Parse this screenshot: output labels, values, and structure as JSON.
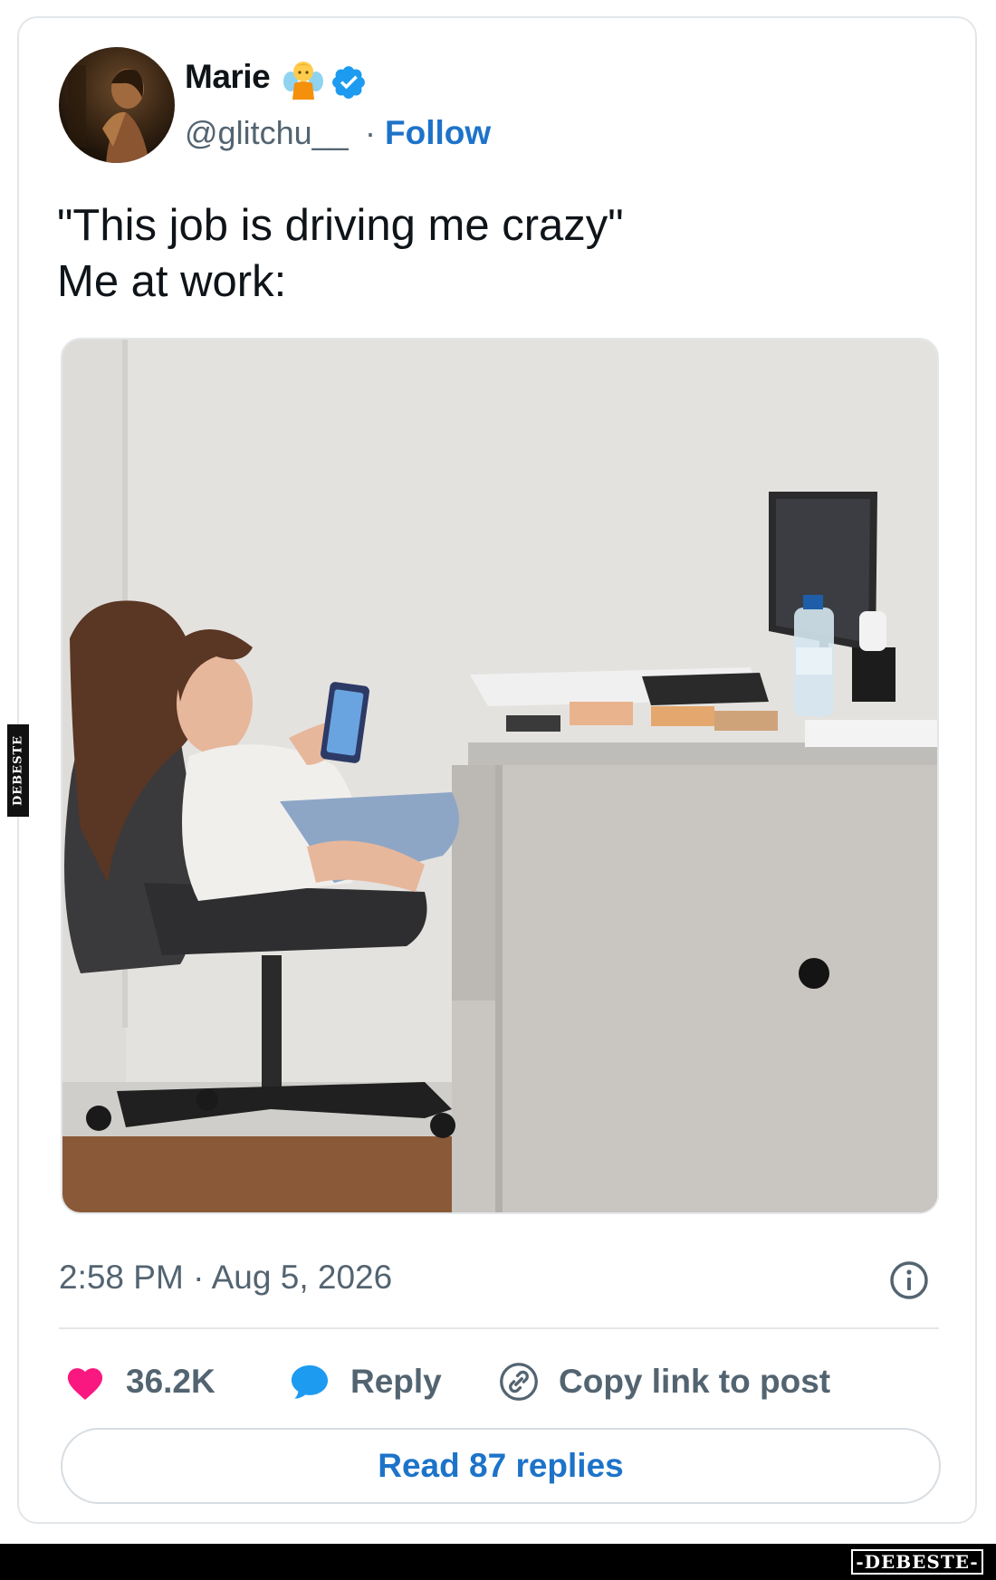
{
  "user": {
    "name": "Marie",
    "handle": "@glitchu__",
    "separator": "·",
    "follow_label": "Follow",
    "avatar_icon": "avatar-photo",
    "emoji_icon": "fairy-emoji",
    "verified_icon": "verified-badge-icon"
  },
  "tweet": {
    "text": "\"This job is driving me crazy\"\nMe at work:",
    "media_description_icon": "office-photo",
    "timestamp": "2:58 PM · Aug 5, 2026"
  },
  "actions": {
    "like_count": "36.2K",
    "reply_label": "Reply",
    "copy_label": "Copy link to post",
    "read_replies_label": "Read 87 replies"
  },
  "watermark": {
    "side": "DEBESTE",
    "brand": "-DEBESTE-"
  },
  "colors": {
    "accent": "#1d73c9",
    "like": "#f91880",
    "reply": "#1d9bf0",
    "text_secondary": "#536471"
  }
}
